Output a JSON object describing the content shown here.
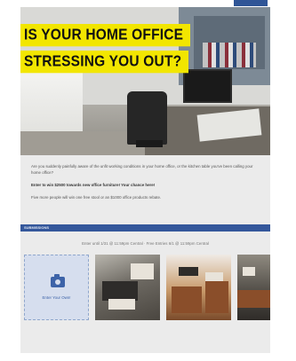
{
  "headline": {
    "line1": "IS YOUR HOME OFFICE",
    "line2": "STRESSING YOU OUT?"
  },
  "body": {
    "para1": "Are you suddenly painfully aware of the unfit working conditions in your home office, or the kitchen table you've been calling your home office?",
    "para2": "Enter to win $2500 towards new office furniture! Your chance here!",
    "para3": "Five more people will win one free stool or an $1000 office products rebate."
  },
  "section_bar": {
    "label": "SUBMISSIONS"
  },
  "gallery": {
    "caption": "Enter until 1/31 @ 11:59pm Central  ·  Free Entries 6/1 @ 11:59pm Central",
    "upload_label": "Enter Your Own!"
  },
  "colors": {
    "headline_bg": "#f2e600",
    "bar": "#34579b",
    "accent": "#3d63a8",
    "card_bg": "#ebebeb"
  }
}
